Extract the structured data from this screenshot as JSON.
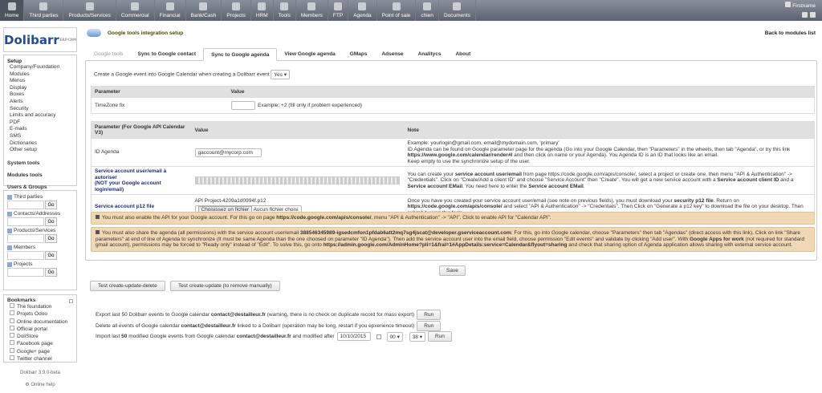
{
  "topmenu": [
    {
      "label": "Home",
      "icon": "home-icon"
    },
    {
      "label": "Third parties",
      "icon": "company-icon"
    },
    {
      "label": "Products/Services",
      "icon": "product-icon"
    },
    {
      "label": "Commercial",
      "icon": "commercial-icon"
    },
    {
      "label": "Financial",
      "icon": "financial-icon"
    },
    {
      "label": "Bank/Cash",
      "icon": "bank-icon"
    },
    {
      "label": "Projects",
      "icon": "projects-icon"
    },
    {
      "label": "HRM",
      "icon": "hrm-icon"
    },
    {
      "label": "Tools",
      "icon": "tools-icon"
    },
    {
      "label": "Members",
      "icon": "members-icon"
    },
    {
      "label": "FTP",
      "icon": "ftp-icon"
    },
    {
      "label": "Agenda",
      "icon": "agenda-icon"
    },
    {
      "label": "Point of sale",
      "icon": "pos-icon"
    },
    {
      "label": "chien",
      "icon": "module-icon"
    },
    {
      "label": "Documents",
      "icon": "documents-icon"
    }
  ],
  "user": {
    "name": "Firstname"
  },
  "logo": {
    "text": "Dolibarr",
    "sub": "ERP/CRM"
  },
  "setup": {
    "title": "Setup",
    "items": [
      "Company/Foundation",
      "Modules",
      "Menus",
      "Display",
      "Boxes",
      "Alerts",
      "Security",
      "Limits and accuracy",
      "PDF",
      "E-mails",
      "SMS",
      "Dictionaries",
      "Other setup"
    ],
    "system_tools": "System tools",
    "modules_tools": "Modules tools",
    "users_groups": "Users & Groups"
  },
  "search": {
    "go": "Go",
    "items": [
      "Third parties",
      "Contacts/Addresses",
      "Products/Services",
      "Members",
      "Projects"
    ]
  },
  "bookmarks": {
    "title": "Bookmarks",
    "items": [
      "The foundation",
      "Projets Odoo",
      "Online documentation",
      "Official portal",
      "DoliStore",
      "Facebook page",
      "Google+ page",
      "Twitter channel"
    ]
  },
  "version": "Dolibarr 3.9.0-beta",
  "online_help": "Online help",
  "page": {
    "title": "Google tools integration setup",
    "back": "Back to modules list"
  },
  "tabs": [
    "Google tools",
    "Sync to Google contact",
    "Sync to Google agenda",
    "View Google agenda",
    "GMaps",
    "Adsense",
    "Analitycs",
    "About"
  ],
  "create_event": {
    "label": "Create a Google event into Google Calendar when creating a Dolibarr event",
    "value": "Yes"
  },
  "table1": {
    "headers": [
      "Parameter",
      "Value"
    ],
    "row": {
      "param": "TimeZone fix",
      "value": "",
      "note": "Example: +2 (fill only if problem experienced)"
    }
  },
  "table2": {
    "headers": [
      "Parameter (For Google API Calendar V3)",
      "Value",
      "Note"
    ],
    "id_agenda": {
      "label": "ID Agenda",
      "value": "gaccount@mycorp.com",
      "note1": "Example: yourlogin@gmail.com, email@mydomain.com, 'primary'",
      "note2": "ID Agenda can be found on Google parameter page for the agenda (Go into your Google Calendar, then \"Parameters\" in the wheels, then tab \"Agenda\", or try this link ",
      "note_link": "https://www.google.com/calendar/render#l",
      "note3": " and then click on name or your Agenda). You Agenda ID is an ID that looks like an email.",
      "note4": "Keep empty to use the synchronize setup of the user."
    },
    "service": {
      "label1": "Service account user/email à autoriser",
      "label2": "(NOT your Google account login/email)",
      "n1": "You can create your ",
      "b1": "service account user/email",
      "n2": " from page https://code.google.com/apis/console/, select a project or create one, then menu \"API & Authentication\" -> \"Credentials\". Click on \"Create/Add a client ID\" and choose \"Service Account\" then \"Create\". You will get a new service account with a ",
      "b2": "Service account client ID",
      "n3": " and a ",
      "b3": "Service account EMail",
      "n4": ". You need here to enter the ",
      "b4": "Service account EMail",
      "n5": "."
    },
    "p12": {
      "label": "Service account p12 file",
      "filename": "API Project-4209a1d0994f.p12",
      "choose": "Choisissez un fichier",
      "nofile": "Aucun fichier choisi",
      "n1": "Once you have you created your service account user/email (see note on previous fields), you must download your ",
      "b1": "security p12 file",
      "n2": ". Return on ",
      "b2": "https://code.google.com/apis/console/",
      "n3": " and select \"API & Authentication\" -> \"Credentials\". Then Click on \"Generate a p12 key\" to download the file on your desktop. Then submit it using this form."
    }
  },
  "warn1": {
    "t1": "You must also enable the API for your Google account. For this go on page ",
    "b1": "https://code.google.com/apis/console/",
    "t2": ", menu \"API & Authentication\" -> \"API\". Click to enable API for \"Calendar API\"."
  },
  "warn2": {
    "t1": "You must also share the agenda (all permissions) with the service account user/email ",
    "b1": "388546345989-igsedcmfon1pfdab6att2mq7sg4jscat@developer.gserviceaccount.com",
    "t2": ": For this, go into Google calendar, choose \"Parameters\" then tab \"Agendas\" (direct access with this link). Click on link \"Share parameters\" at end of line of Agenda to synchronize (It must be same Agenda than the one choosed on parameter \"ID Agenda\"). Then add the service account user into the email field, choose permission \"Edit events\" and validate by clicking \"Add user\". With ",
    "b2": "Google Apps for work",
    "t3": " (not required for standard gmail account), permissions may be forced to \"Ready only\" instead of \"Edit\". To solve this, go onto ",
    "b3": "https://admin.google.com/AdminHome?pli=1&fral=1#AppDetails:service=Calendar&flyout=sharing",
    "t4": " and check that sharing option of Agenda application allows sharing with external service account."
  },
  "save": "Save",
  "test1": "Test create-update-delete",
  "test2": "Test create-update (to remove manually)",
  "export": {
    "t1": "Export last 50 Dolibarr events to Google calendar ",
    "b": "contact@destailleur.fr",
    "t2": " (warning, there is no check on duplicate record for mass export)"
  },
  "delete": {
    "t1": "Delete all events of Google calendar ",
    "b": "contact@destailleur.fr",
    "t2": " linked to a Dolibarr (operation may be long, restart if you epxerience timeout)"
  },
  "import": {
    "t1": "Import last ",
    "n": "50",
    "t2": " modified Google events from Google calendar ",
    "b": "contact@destailleur.fr",
    "t3": " and modified after",
    "date": "10/10/2015",
    "hour": "00",
    "min": "38"
  },
  "run": "Run"
}
